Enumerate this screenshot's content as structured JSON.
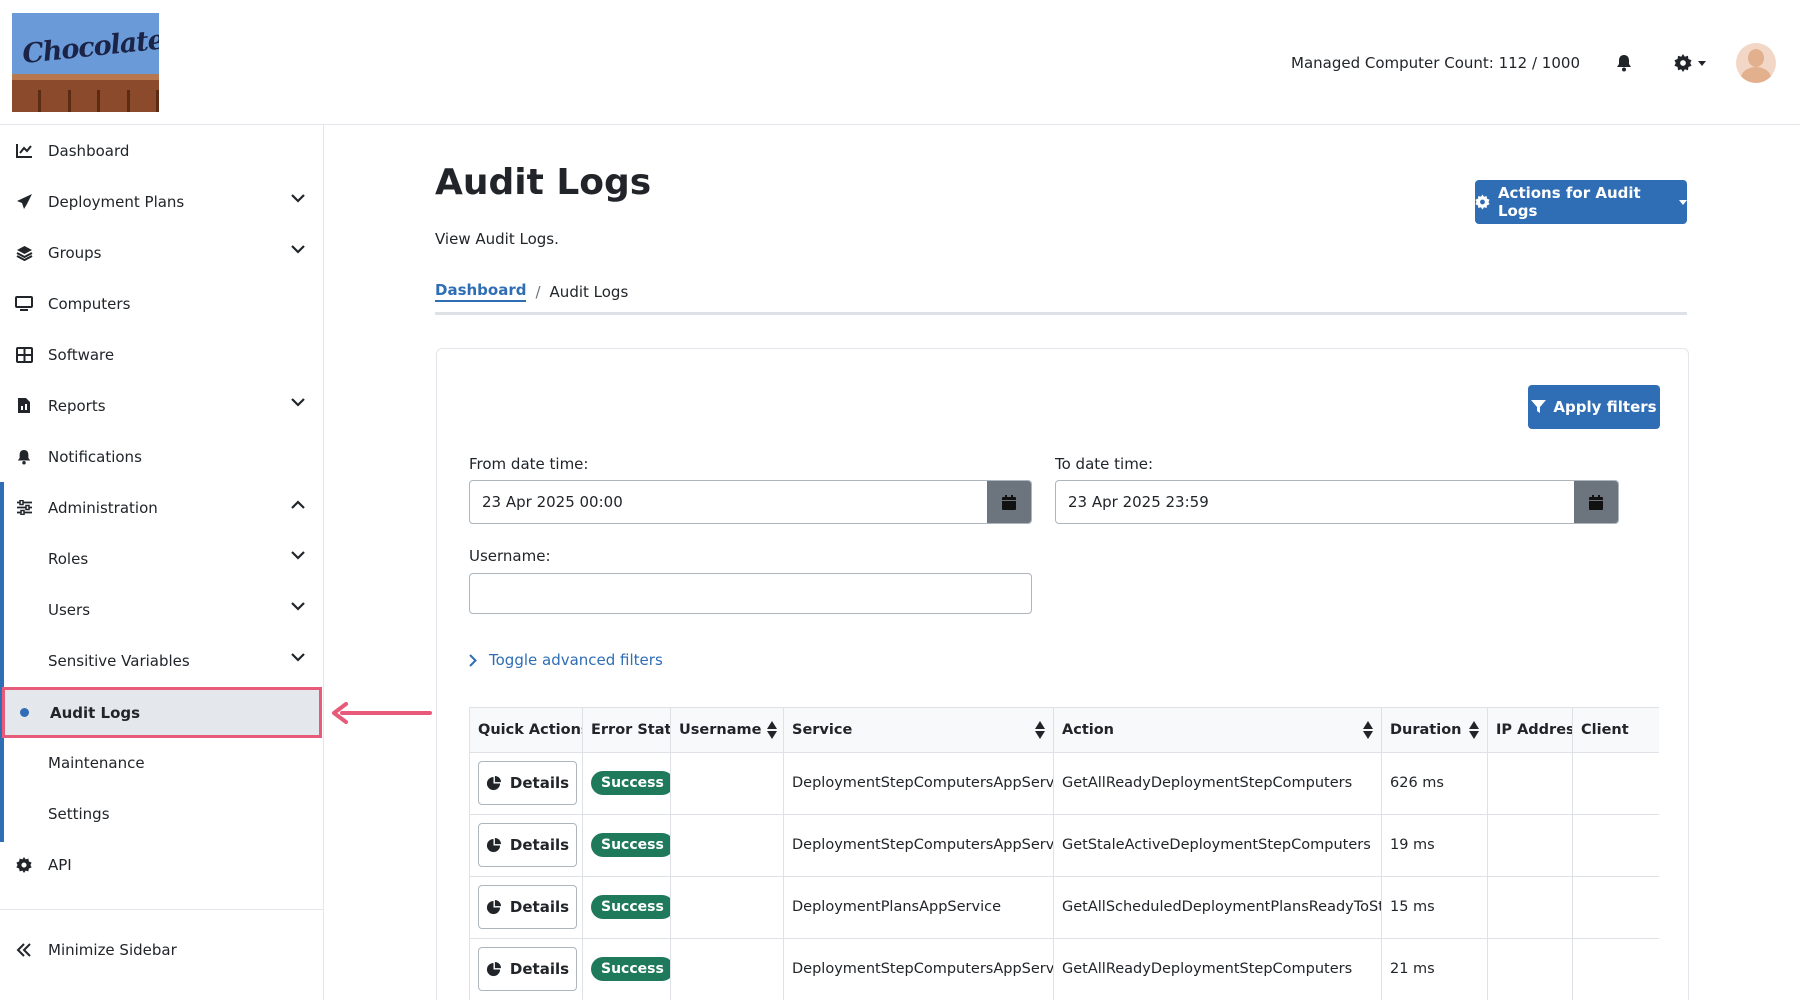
{
  "header": {
    "logo_text": "Chocolatey",
    "managed_count": "Managed Computer Count: 112 / 1000"
  },
  "sidebar": {
    "items": [
      {
        "label": "Dashboard",
        "icon": "chart-line-icon"
      },
      {
        "label": "Deployment Plans",
        "icon": "paper-plane-icon"
      },
      {
        "label": "Groups",
        "icon": "layers-icon"
      },
      {
        "label": "Computers",
        "icon": "desktop-icon"
      },
      {
        "label": "Software",
        "icon": "grid-icon"
      },
      {
        "label": "Reports",
        "icon": "file-report-icon"
      },
      {
        "label": "Notifications",
        "icon": "bell-icon"
      },
      {
        "label": "Administration",
        "icon": "sliders-icon"
      },
      {
        "label": "Roles"
      },
      {
        "label": "Users"
      },
      {
        "label": "Sensitive Variables"
      },
      {
        "label": "Audit Logs"
      },
      {
        "label": "Maintenance"
      },
      {
        "label": "Settings"
      },
      {
        "label": "API",
        "icon": "gear-icon"
      }
    ],
    "minimize_label": "Minimize Sidebar"
  },
  "main": {
    "title": "Audit Logs",
    "subtitle": "View Audit Logs.",
    "actions_label": "Actions for Audit Logs",
    "breadcrumb": {
      "home": "Dashboard",
      "current": "Audit Logs",
      "separator": "/"
    }
  },
  "filters": {
    "apply_label": "Apply filters",
    "from_label": "From date time:",
    "from_value": "23 Apr 2025 00:00",
    "to_label": "To date time:",
    "to_value": "23 Apr 2025 23:59",
    "username_label": "Username:",
    "username_value": "",
    "toggle_label": "Toggle advanced filters"
  },
  "table": {
    "columns": [
      "Quick Actions",
      "Error State",
      "Username",
      "Service",
      "Action",
      "Duration",
      "IP Address",
      "Client"
    ],
    "details_label": "Details",
    "rows": [
      {
        "state": "Success",
        "username": "",
        "service": "DeploymentStepComputersAppService",
        "action": "GetAllReadyDeploymentStepComputers",
        "duration": "626 ms",
        "ip": "",
        "client": ""
      },
      {
        "state": "Success",
        "username": "",
        "service": "DeploymentStepComputersAppService",
        "action": "GetStaleActiveDeploymentStepComputers",
        "duration": "19 ms",
        "ip": "",
        "client": ""
      },
      {
        "state": "Success",
        "username": "",
        "service": "DeploymentPlansAppService",
        "action": "GetAllScheduledDeploymentPlansReadyToStart",
        "duration": "15 ms",
        "ip": "",
        "client": ""
      },
      {
        "state": "Success",
        "username": "",
        "service": "DeploymentStepComputersAppService",
        "action": "GetAllReadyDeploymentStepComputers",
        "duration": "21 ms",
        "ip": "",
        "client": ""
      }
    ]
  },
  "colors": {
    "accent": "#2f6db5",
    "success": "#1f7a5b",
    "highlight": "#e85a7a"
  }
}
